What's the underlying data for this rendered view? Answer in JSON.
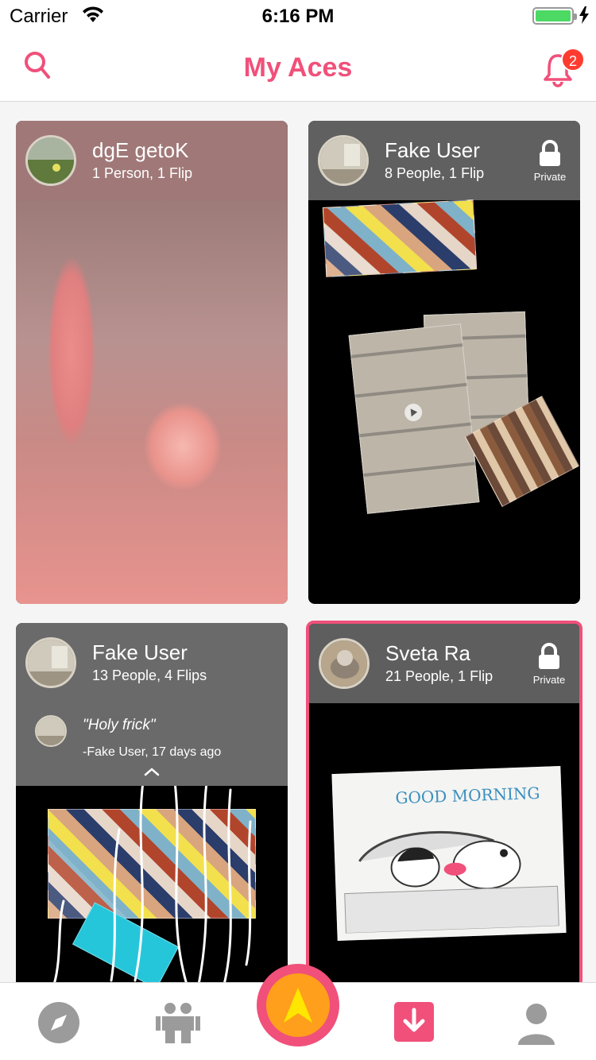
{
  "status_bar": {
    "carrier": "Carrier",
    "time": "6:16 PM"
  },
  "header": {
    "title": "My Aces",
    "notification_count": "2"
  },
  "cards": [
    {
      "name": "dgE getoK",
      "meta": "1 Person, 1 Flip",
      "private": false
    },
    {
      "name": "Fake User",
      "meta": "8 People, 1 Flip",
      "private": true,
      "private_label": "Private"
    },
    {
      "name": "Fake User",
      "meta": "13 People, 4 Flips",
      "private": false,
      "comment": {
        "text": "\"Holy frick\"",
        "author": "-Fake User, 17 days ago"
      }
    },
    {
      "name": "Sveta Ra",
      "meta": "21 People, 1 Flip",
      "private": true,
      "private_label": "Private",
      "image_caption": "GOOD MORNING"
    }
  ],
  "tabbar": {
    "items": [
      "compass-icon",
      "people-icon",
      "ace-icon",
      "download-icon",
      "profile-icon"
    ],
    "accent": "#f0507a",
    "fab_color": "#ff9f1c"
  }
}
